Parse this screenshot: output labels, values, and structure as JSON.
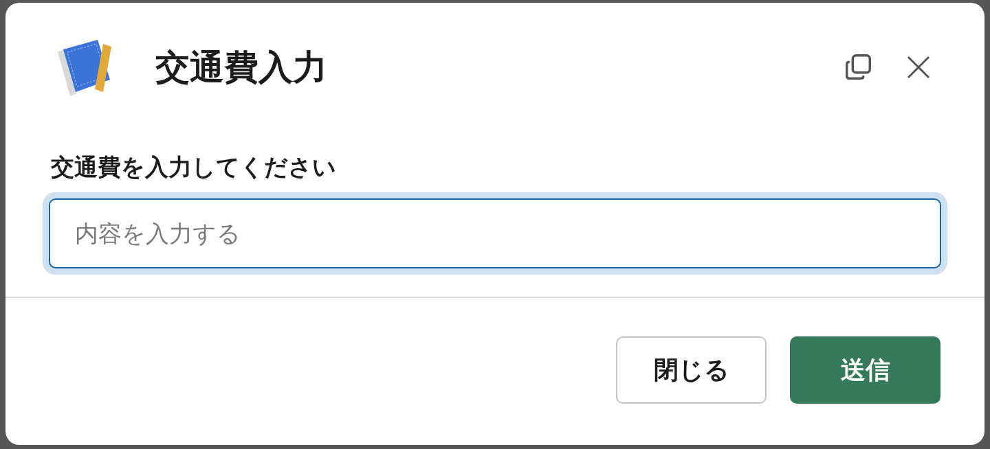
{
  "modal": {
    "title": "交通費入力"
  },
  "field": {
    "label": "交通費を入力してください",
    "placeholder": "内容を入力する"
  },
  "buttons": [
    {
      "label": "閉じる",
      "kind": "secondary"
    },
    {
      "label": "送信",
      "kind": "primary"
    }
  ]
}
